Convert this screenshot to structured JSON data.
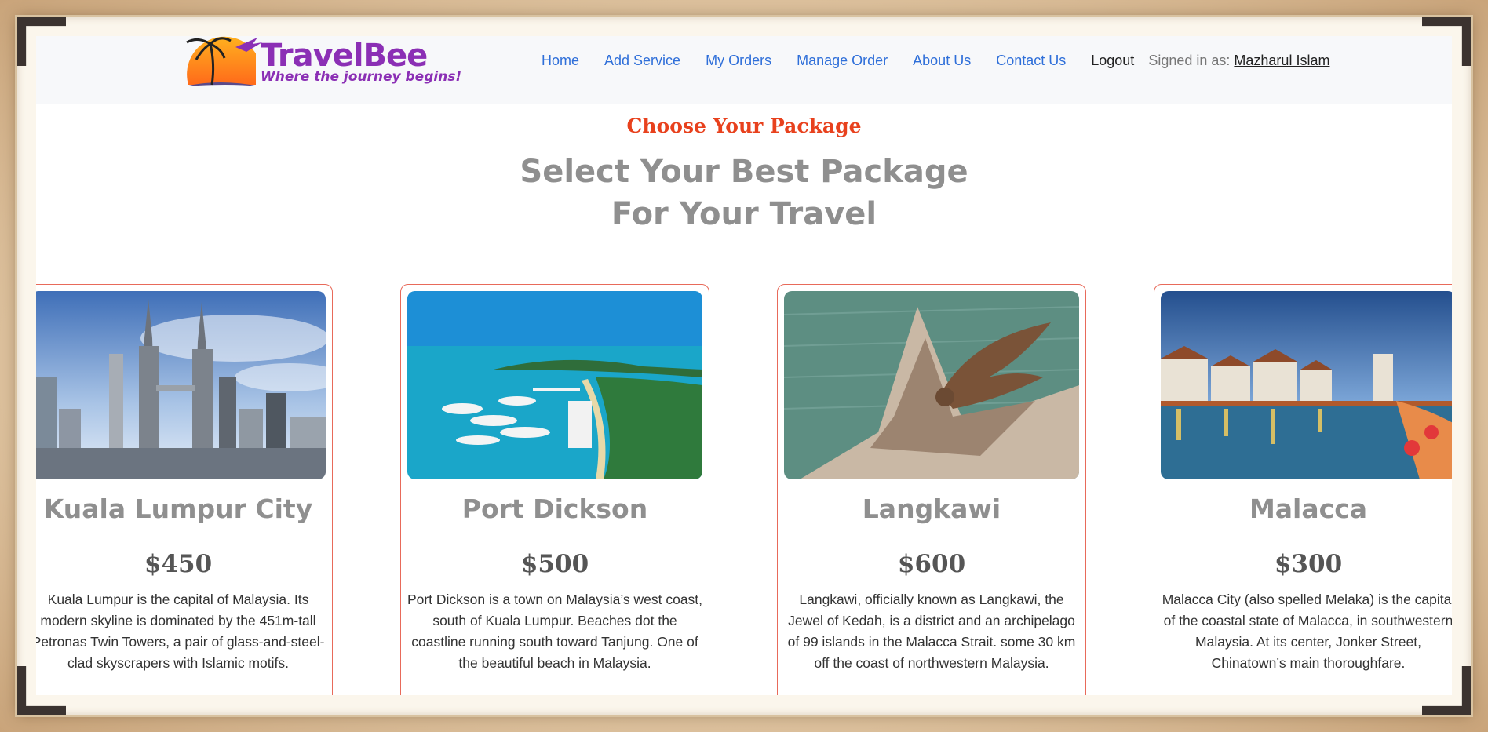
{
  "brand": {
    "name": "TravelBee",
    "tagline": "Where the journey begins!",
    "colors": {
      "primary": "#8b2fb5",
      "accent": "#e8411d",
      "button": "#e9707f"
    }
  },
  "nav": {
    "links": [
      "Home",
      "Add Service",
      "My Orders",
      "Manage Order",
      "About Us",
      "Contact Us"
    ],
    "logout": "Logout",
    "signed_in_label": "Signed in as:",
    "user_name": "Mazharul Islam"
  },
  "section": {
    "subtitle": "Choose Your Package",
    "title_line1": "Select Your Best Package",
    "title_line2": "For Your Travel"
  },
  "packages": [
    {
      "title": "Kuala Lumpur City",
      "price": "$450",
      "description": "Kuala Lumpur is the capital of Malaysia. Its modern skyline is dominated by the 451m-tall Petronas Twin Towers, a pair of glass-and-steel-clad skyscrapers with Islamic motifs.",
      "image": "city-skyline-photo"
    },
    {
      "title": "Port Dickson",
      "price": "$500",
      "description": "Port Dickson is a town on Malaysia’s west coast, south of Kuala Lumpur. Beaches dot the coastline running south toward Tanjung. One of the beautiful beach in Malaysia.",
      "image": "beach-resort-photo"
    },
    {
      "title": "Langkawi",
      "price": "$600",
      "description": "Langkawi, officially known as Langkawi, the Jewel of Kedah, is a district and an archipelago of 99 islands in the Malacca Strait. some 30 km off the coast of northwestern Malaysia.",
      "image": "eagle-square-photo"
    },
    {
      "title": "Malacca",
      "price": "$300",
      "description": "Malacca City (also spelled Melaka) is the capital of the coastal state of Malacca, in southwestern Malaysia. At its center, Jonker Street, Chinatown’s main thoroughfare.",
      "image": "river-town-photo"
    }
  ]
}
